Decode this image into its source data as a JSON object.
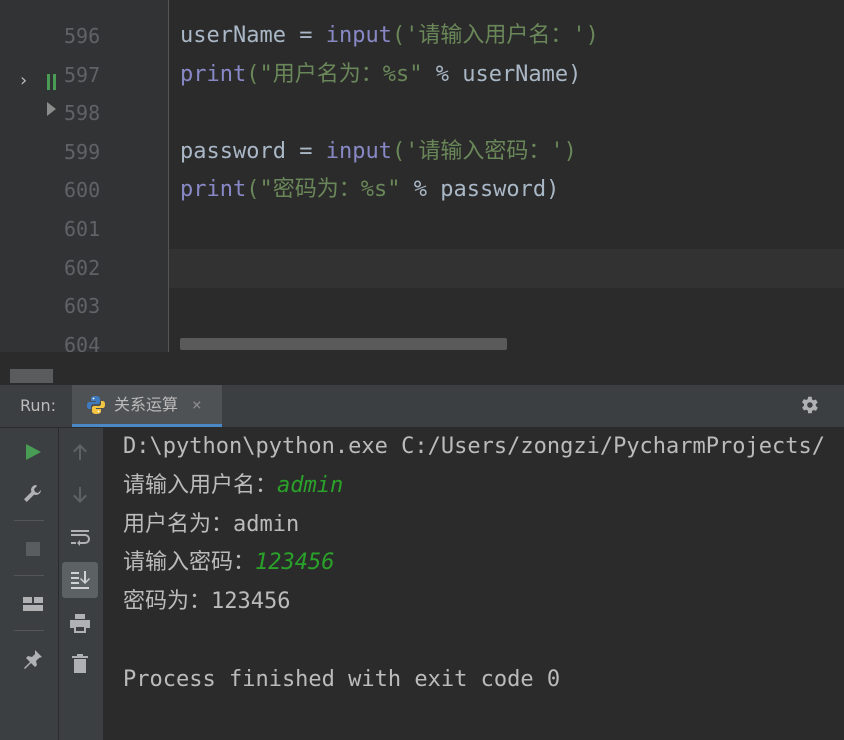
{
  "editor": {
    "lines": [
      {
        "num": "596",
        "tokens": [
          {
            "t": "userName = ",
            "c": "id"
          },
          {
            "t": "input",
            "c": "fn"
          },
          {
            "t": "('请输入用户名：')",
            "c": "str"
          }
        ]
      },
      {
        "num": "597",
        "tokens": [
          {
            "t": "print",
            "c": "fn"
          },
          {
            "t": "(\"用户名为：%s\"",
            "c": "str"
          },
          {
            "t": " % userName)",
            "c": "id"
          }
        ]
      },
      {
        "num": "598",
        "tokens": []
      },
      {
        "num": "599",
        "tokens": [
          {
            "t": "password = ",
            "c": "id"
          },
          {
            "t": "input",
            "c": "fn"
          },
          {
            "t": "('请输入密码：')",
            "c": "str"
          }
        ]
      },
      {
        "num": "600",
        "tokens": [
          {
            "t": "print",
            "c": "fn"
          },
          {
            "t": "(\"密码为：%s\"",
            "c": "str"
          },
          {
            "t": " % password)",
            "c": "id"
          }
        ]
      },
      {
        "num": "601",
        "tokens": []
      },
      {
        "num": "602",
        "tokens": []
      },
      {
        "num": "603",
        "tokens": []
      },
      {
        "num": "604",
        "tokens": []
      }
    ],
    "current_line": "602"
  },
  "run": {
    "label": "Run:",
    "tab_title": "关系运算",
    "tab_close": "×"
  },
  "console": {
    "lines": [
      {
        "segments": [
          {
            "t": "D:\\python\\python.exe C:/Users/zongzi/PycharmProjects/",
            "input": false
          }
        ]
      },
      {
        "segments": [
          {
            "t": "请输入用户名：",
            "input": false
          },
          {
            "t": "admin",
            "input": true
          }
        ]
      },
      {
        "segments": [
          {
            "t": "用户名为：admin",
            "input": false
          }
        ]
      },
      {
        "segments": [
          {
            "t": "请输入密码：",
            "input": false
          },
          {
            "t": "123456",
            "input": true
          }
        ]
      },
      {
        "segments": [
          {
            "t": "密码为：123456",
            "input": false
          }
        ]
      },
      {
        "segments": []
      },
      {
        "segments": [
          {
            "t": "Process finished with exit code 0",
            "input": false
          }
        ]
      }
    ]
  },
  "icons": {
    "run": "run-icon",
    "wrench": "wrench-icon",
    "stop": "stop-icon",
    "layout": "layout-icon",
    "pin": "pin-icon",
    "up": "arrow-up-icon",
    "down": "arrow-down-icon",
    "wrap": "soft-wrap-icon",
    "scroll": "scroll-to-end-icon",
    "print": "print-icon",
    "trash": "trash-icon",
    "settings": "gear-icon",
    "python": "python-icon"
  }
}
